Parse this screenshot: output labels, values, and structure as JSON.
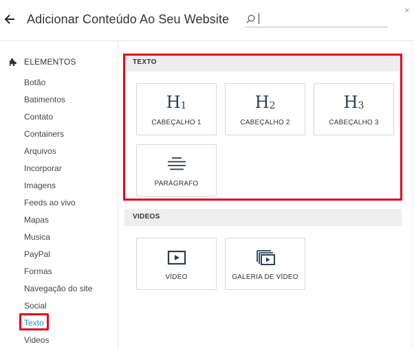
{
  "header": {
    "title": "Adicionar Conteúdo Ao Seu Website",
    "search_value": "",
    "close_glyph": "×"
  },
  "sidebar": {
    "heading": "ELEMENTOS",
    "items": [
      {
        "label": "Botão"
      },
      {
        "label": "Batimentos"
      },
      {
        "label": "Contato"
      },
      {
        "label": "Containers"
      },
      {
        "label": "Arquivos"
      },
      {
        "label": "Incorporar"
      },
      {
        "label": "Imagens"
      },
      {
        "label": "Feeds ao vivo"
      },
      {
        "label": "Mapas"
      },
      {
        "label": "Musica"
      },
      {
        "label": "PayPal"
      },
      {
        "label": "Formas"
      },
      {
        "label": "Navegação do site"
      },
      {
        "label": "Social"
      },
      {
        "label": "Texto"
      },
      {
        "label": "Videos"
      }
    ],
    "active_item": "Texto"
  },
  "sections": {
    "texto": {
      "title": "TEXTO",
      "cards": [
        {
          "glyph": "H",
          "sub": "1",
          "label": "CABEÇALHO 1",
          "icon": "heading-1-icon"
        },
        {
          "glyph": "H",
          "sub": "2",
          "label": "CABEÇALHO 2",
          "icon": "heading-2-icon"
        },
        {
          "glyph": "H",
          "sub": "3",
          "label": "CABEÇALHO 3",
          "icon": "heading-3-icon"
        },
        {
          "label": "PARÁGRAFO",
          "icon": "paragraph-icon"
        }
      ]
    },
    "videos": {
      "title": "VIDEOS",
      "cards": [
        {
          "label": "VÍDEO",
          "icon": "video-icon"
        },
        {
          "label": "GALERIA DE VÍDEO",
          "icon": "video-gallery-icon"
        }
      ]
    }
  },
  "colors": {
    "accent_link": "#1a8fd6",
    "highlight_red": "#e3001b",
    "section_bar": "#eeeeee",
    "icon_dark": "#2c3e50"
  }
}
